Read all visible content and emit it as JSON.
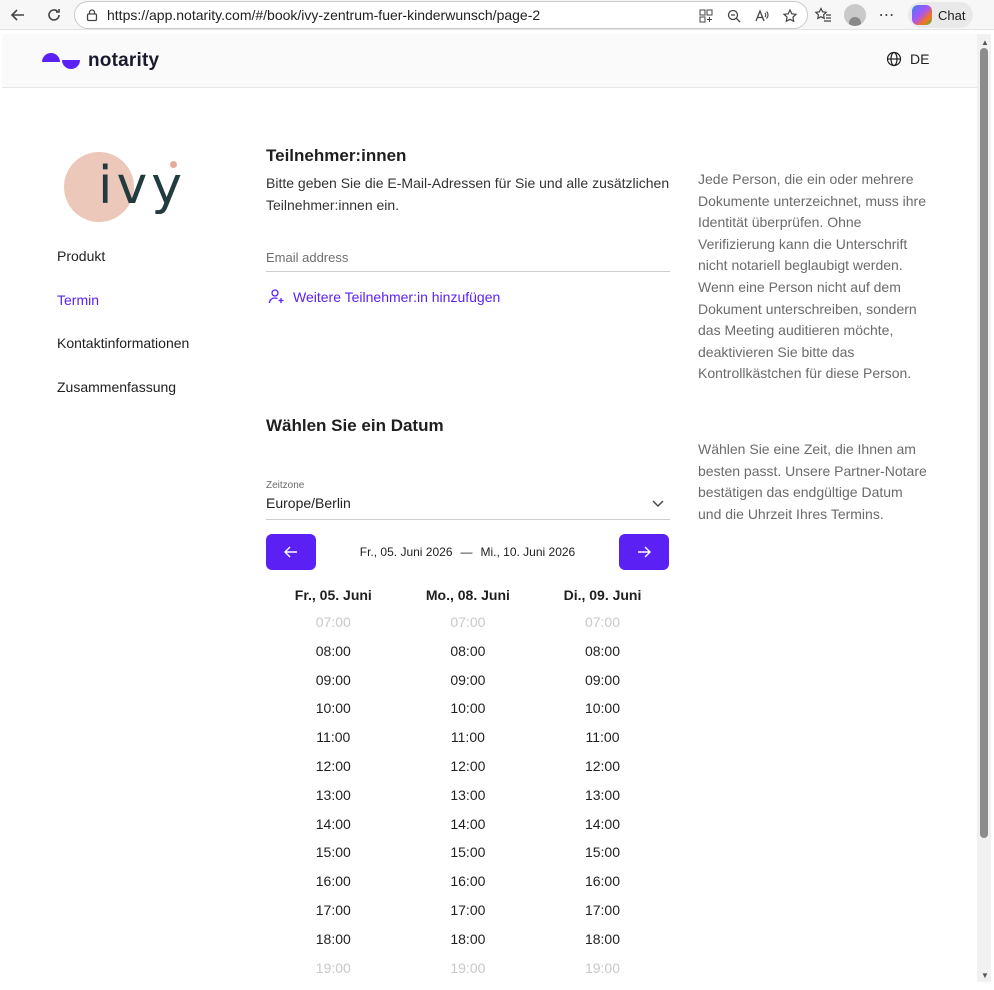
{
  "browser": {
    "url": "https://app.notarity.com/#/book/ivy-zentrum-fuer-kinderwunsch/page-2",
    "chat_label": "Chat"
  },
  "header": {
    "logo_text": "notarity",
    "language": "DE"
  },
  "brand": {
    "name": "ivy",
    "accent_color": "#5b21f4"
  },
  "sidebar": {
    "items": [
      {
        "label": "Produkt",
        "active": false
      },
      {
        "label": "Termin",
        "active": true
      },
      {
        "label": "Kontaktinformationen",
        "active": false
      },
      {
        "label": "Zusammenfassung",
        "active": false
      }
    ]
  },
  "participants": {
    "title": "Teilnehmer:innen",
    "description": "Bitte geben Sie die E-Mail-Adressen für Sie und alle zusätzlichen Teilnehmer:innen ein.",
    "email_placeholder": "Email address",
    "email_value": "",
    "add_participant_label": "Weitere Teilnehmer:in hinzufügen",
    "info": "Jede Person, die ein oder mehrere Dokumente unterzeichnet, muss ihre Identität überprüfen. Ohne Verifizierung kann die Unterschrift nicht notariell beglaubigt werden. Wenn eine Person nicht auf dem Dokument unterschreiben, sondern das Meeting auditieren möchte, deaktivieren Sie bitte das Kontrollkästchen für diese Person."
  },
  "date_picker": {
    "title": "Wählen Sie ein Datum",
    "timezone_label": "Zeitzone",
    "timezone_value": "Europe/Berlin",
    "range_start": "Fr., 05. Juni 2026",
    "range_separator": "—",
    "range_end": "Mi., 10. Juni 2026",
    "info": "Wählen Sie eine Zeit, die Ihnen am besten passt. Unsere Partner-Notare bestätigen das endgültige Datum und die Uhrzeit Ihres Termins.",
    "days": [
      {
        "label": "Fr., 05. Juni",
        "slots": [
          {
            "time": "07:00",
            "available": false
          },
          {
            "time": "08:00",
            "available": true
          },
          {
            "time": "09:00",
            "available": true
          },
          {
            "time": "10:00",
            "available": true
          },
          {
            "time": "11:00",
            "available": true
          },
          {
            "time": "12:00",
            "available": true
          },
          {
            "time": "13:00",
            "available": true
          },
          {
            "time": "14:00",
            "available": true
          },
          {
            "time": "15:00",
            "available": true
          },
          {
            "time": "16:00",
            "available": true
          },
          {
            "time": "17:00",
            "available": true
          },
          {
            "time": "18:00",
            "available": true
          },
          {
            "time": "19:00",
            "available": false
          }
        ]
      },
      {
        "label": "Mo., 08. Juni",
        "slots": [
          {
            "time": "07:00",
            "available": false
          },
          {
            "time": "08:00",
            "available": true
          },
          {
            "time": "09:00",
            "available": true
          },
          {
            "time": "10:00",
            "available": true
          },
          {
            "time": "11:00",
            "available": true
          },
          {
            "time": "12:00",
            "available": true
          },
          {
            "time": "13:00",
            "available": true
          },
          {
            "time": "14:00",
            "available": true
          },
          {
            "time": "15:00",
            "available": true
          },
          {
            "time": "16:00",
            "available": true
          },
          {
            "time": "17:00",
            "available": true
          },
          {
            "time": "18:00",
            "available": true
          },
          {
            "time": "19:00",
            "available": false
          }
        ]
      },
      {
        "label": "Di., 09. Juni",
        "slots": [
          {
            "time": "07:00",
            "available": false
          },
          {
            "time": "08:00",
            "available": true
          },
          {
            "time": "09:00",
            "available": true
          },
          {
            "time": "10:00",
            "available": true
          },
          {
            "time": "11:00",
            "available": true
          },
          {
            "time": "12:00",
            "available": true
          },
          {
            "time": "13:00",
            "available": true
          },
          {
            "time": "14:00",
            "available": true
          },
          {
            "time": "15:00",
            "available": true
          },
          {
            "time": "16:00",
            "available": true
          },
          {
            "time": "17:00",
            "available": true
          },
          {
            "time": "18:00",
            "available": true
          },
          {
            "time": "19:00",
            "available": false
          }
        ]
      }
    ]
  },
  "icons": {
    "back": "back-arrow-icon",
    "reload": "reload-icon",
    "lock": "lock-icon",
    "language": "globe-icon",
    "add_person": "add-person-icon",
    "prev": "arrow-left-icon",
    "next": "arrow-right-icon",
    "dropdown": "chevron-down-icon"
  }
}
